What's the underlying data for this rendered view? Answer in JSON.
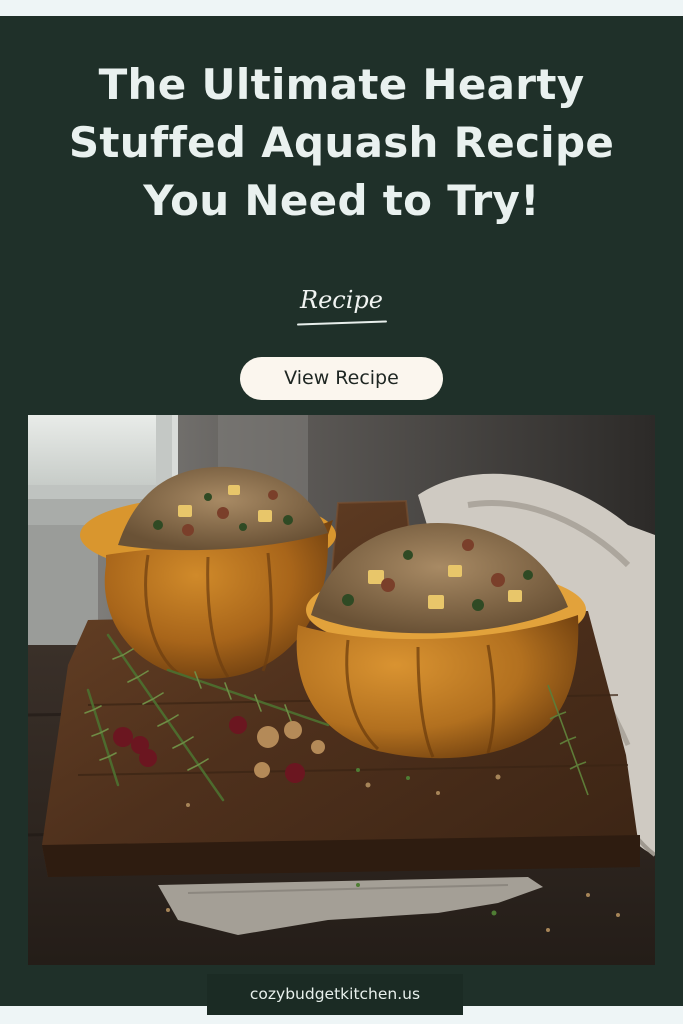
{
  "headline": {
    "lines": [
      "The Ultimate Hearty",
      "Stuffed Aquash Recipe",
      "You Need to Try!"
    ]
  },
  "tagline": "Recipe",
  "cta": {
    "label": "View Recipe"
  },
  "photo": {
    "subject": "stuffed-acorn-squash-halves-on-wooden-board"
  },
  "footer": {
    "site": "cozybudgetkitchen.us"
  },
  "colors": {
    "background": "#1f3029",
    "title": "#e9f1ef",
    "button": "#fbf6ee",
    "squash": "#b8741f"
  }
}
